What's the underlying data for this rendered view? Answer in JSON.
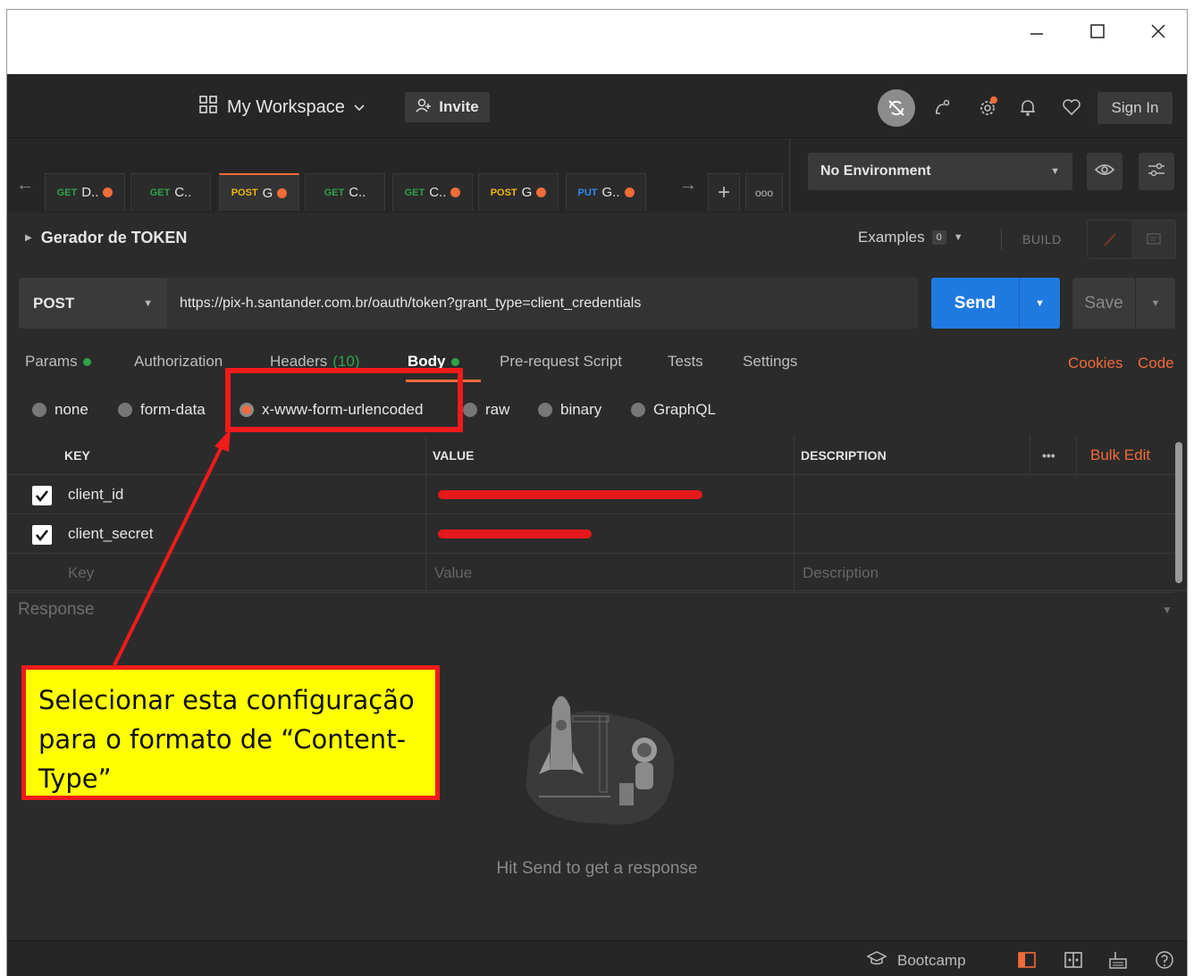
{
  "window": {
    "minimize_icon": "minimize-icon",
    "maximize_icon": "maximize-icon",
    "close_icon": "close-icon"
  },
  "header": {
    "workspace": "My Workspace",
    "invite": "Invite",
    "sign_in": "Sign In"
  },
  "tabs": [
    {
      "method": "GET",
      "name": "D..",
      "dirty": true,
      "active": false
    },
    {
      "method": "GET",
      "name": "C..",
      "dirty": false,
      "active": false
    },
    {
      "method": "POST",
      "name": "G",
      "dirty": true,
      "active": true
    },
    {
      "method": "GET",
      "name": "C..",
      "dirty": false,
      "active": false
    },
    {
      "method": "GET",
      "name": "C..",
      "dirty": true,
      "active": false
    },
    {
      "method": "POST",
      "name": "G",
      "dirty": true,
      "active": false
    },
    {
      "method": "PUT",
      "name": "G..",
      "dirty": true,
      "active": false
    }
  ],
  "environment": {
    "selected": "No Environment"
  },
  "request": {
    "name": "Gerador de TOKEN",
    "examples_label": "Examples",
    "examples_count": "0",
    "build_label": "BUILD",
    "method": "POST",
    "url": "https://pix-h.santander.com.br/oauth/token?grant_type=client_credentials",
    "send": "Send",
    "save": "Save"
  },
  "request_tabs": {
    "params": "Params",
    "authorization": "Authorization",
    "headers": "Headers",
    "headers_count": "(10)",
    "body": "Body",
    "pre_request": "Pre-request Script",
    "tests": "Tests",
    "settings": "Settings",
    "cookies": "Cookies",
    "code": "Code"
  },
  "body_types": {
    "none": "none",
    "form_data": "form-data",
    "urlencoded": "x-www-form-urlencoded",
    "raw": "raw",
    "binary": "binary",
    "graphql": "GraphQL",
    "selected": "x-www-form-urlencoded"
  },
  "table": {
    "headers": {
      "key": "KEY",
      "value": "VALUE",
      "description": "DESCRIPTION",
      "more": "•••",
      "bulk_edit": "Bulk Edit"
    },
    "rows": [
      {
        "checked": true,
        "key": "client_id",
        "value_redacted": true
      },
      {
        "checked": true,
        "key": "client_secret",
        "value_redacted": true
      }
    ],
    "placeholders": {
      "key": "Key",
      "value": "Value",
      "description": "Description"
    }
  },
  "response": {
    "label": "Response",
    "empty_message": "Hit Send to get a response"
  },
  "footer": {
    "bootcamp": "Bootcamp"
  },
  "annotation": {
    "callout_text": "Selecionar esta configuração para o formato de “Content-Type”",
    "highlight_color": "#f01b1b",
    "callout_bg": "#ffff00"
  },
  "colors": {
    "accent": "#f26b3a",
    "send_blue": "#1f7ae0",
    "get_green": "#2fa34b",
    "post_yellow": "#f2b90c",
    "put_blue": "#2d8cf0"
  }
}
